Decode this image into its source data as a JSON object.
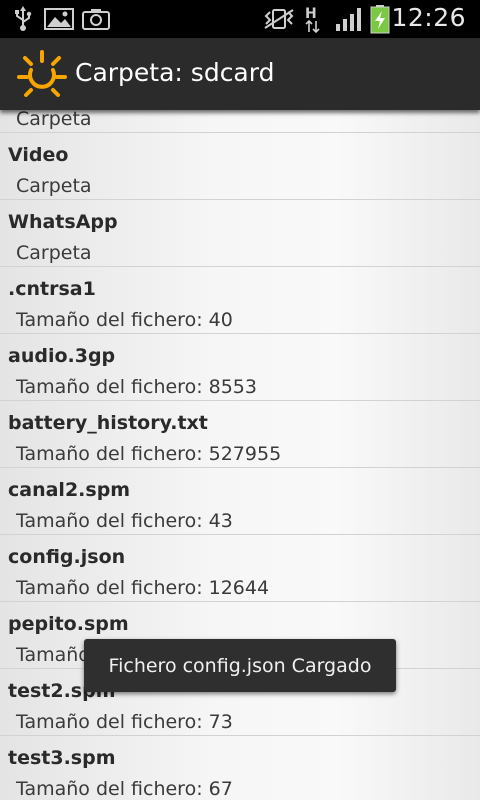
{
  "status_bar": {
    "time": "12:26",
    "network_type": "H",
    "icons": [
      "usb-icon",
      "gallery-icon",
      "camera-icon",
      "vibrate-icon",
      "data-arrows-icon",
      "signal-bars-icon",
      "battery-charging-icon"
    ],
    "battery_color": "#7ac943"
  },
  "action_bar": {
    "title": "Carpeta: sdcard",
    "icon": "sun-icon",
    "icon_color": "#f7a600"
  },
  "files": [
    {
      "name": "",
      "detail": "Carpeta"
    },
    {
      "name": "Video",
      "detail": "Carpeta"
    },
    {
      "name": "WhatsApp",
      "detail": "Carpeta"
    },
    {
      "name": ".cntrsa1",
      "detail": "Tamaño del fichero: 40"
    },
    {
      "name": "audio.3gp",
      "detail": "Tamaño del fichero: 8553"
    },
    {
      "name": "battery_history.txt",
      "detail": "Tamaño del fichero: 527955"
    },
    {
      "name": "canal2.spm",
      "detail": "Tamaño del fichero: 43"
    },
    {
      "name": "config.json",
      "detail": "Tamaño del fichero: 12644"
    },
    {
      "name": "pepito.spm",
      "detail": "Tamaño del fichero: 37"
    },
    {
      "name": "test2.spm",
      "detail": "Tamaño del fichero: 73"
    },
    {
      "name": "test3.spm",
      "detail": "Tamaño del fichero: 67"
    }
  ],
  "toast": {
    "message": "Fichero config.json Cargado"
  }
}
